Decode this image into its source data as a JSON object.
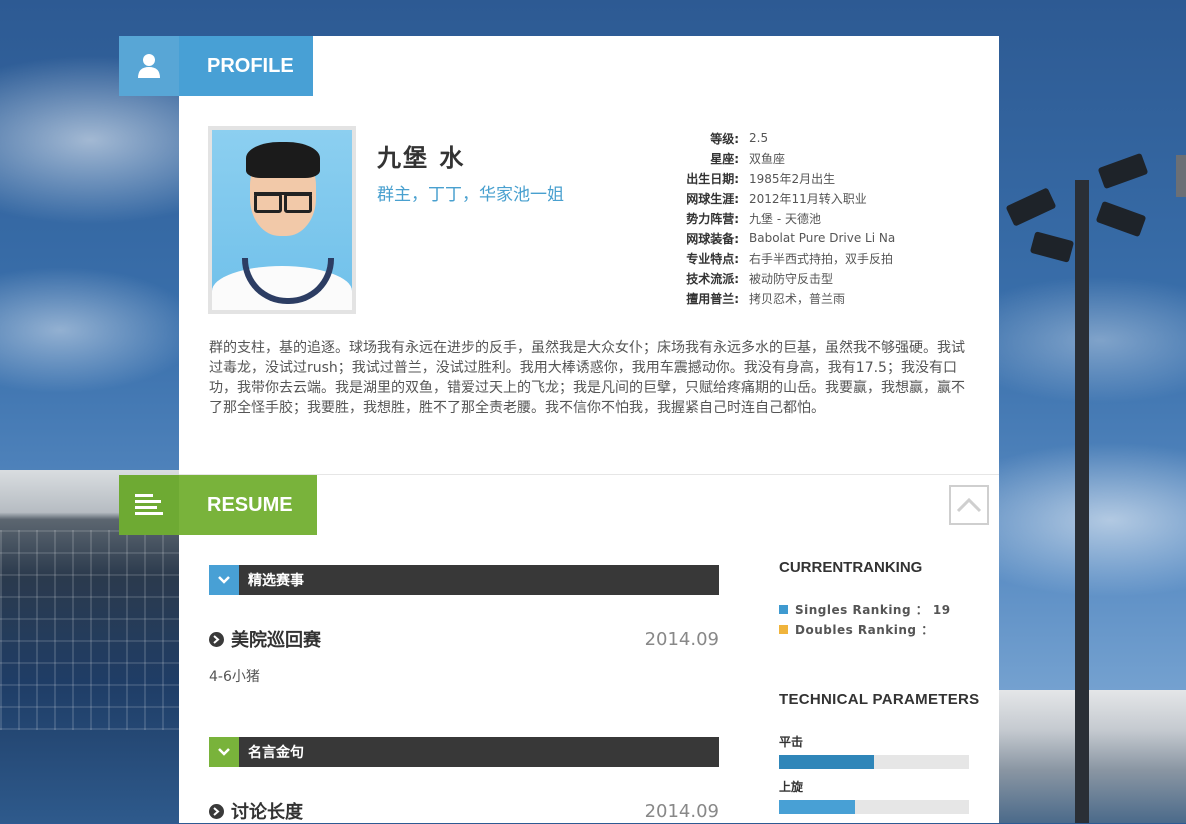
{
  "profile_tab": {
    "label": "PROFILE",
    "icon": "user-icon"
  },
  "resume_tab": {
    "label": "RESUME",
    "icon": "list-icon"
  },
  "player": {
    "name": "九堡 水",
    "aliases": "群主，丁丁，华家池一姐"
  },
  "info": [
    {
      "key": "等级:",
      "value": "2.5"
    },
    {
      "key": "星座:",
      "value": "双鱼座"
    },
    {
      "key": "出生日期:",
      "value": "1985年2月出生"
    },
    {
      "key": "网球生涯:",
      "value": "2012年11月转入职业"
    },
    {
      "key": "势力阵营:",
      "value": "九堡 - 天德池"
    },
    {
      "key": "网球装备:",
      "value": "Babolat Pure Drive Li Na"
    },
    {
      "key": "专业特点:",
      "value": "右手半西式持拍，双手反拍"
    },
    {
      "key": "技术流派:",
      "value": "被动防守反击型"
    },
    {
      "key": "擅用普兰:",
      "value": "拷贝忍术，普兰雨"
    }
  ],
  "bio": "群的支柱，基的追逐。球场我有永远在进步的反手，虽然我是大众女仆；床场我有永远多水的巨基，虽然我不够强硬。我试过毒龙，没试过rush；我试过普兰，没试过胜利。我用大棒诱惑你，我用车震撼动你。我没有身高，我有17.5；我没有口功，我带你去云端。我是湖里的双鱼，错爱过天上的飞龙；我是凡间的巨擘，只赋给疼痛期的山岳。我要赢，我想赢，赢不了那全怪手胶；我要胜，我想胜，胜不了那全责老腰。我不信你不怕我，我握紧自己时连自己都怕。",
  "sections": [
    {
      "title": "精选赛事",
      "color": "#48a0d5",
      "entry": {
        "title": "美院巡回赛",
        "date": "2014.09",
        "desc": "4-6小猪"
      }
    },
    {
      "title": "名言金句",
      "color": "#79b33b",
      "entry": {
        "title": "讨论长度",
        "date": "2014.09",
        "desc": ""
      }
    }
  ],
  "ranking": {
    "title": "CURRENTRANKING",
    "singles": "Singles Ranking ： 19",
    "doubles": "Doubles Ranking ：",
    "singles_color": "#3f9ad0",
    "doubles_color": "#f0b43c"
  },
  "technical": {
    "title": "TECHNICAL PARAMETERS",
    "params": [
      {
        "label": "平击",
        "level": 0.5,
        "color": "#2f86b9"
      },
      {
        "label": "上旋",
        "level": 0.4,
        "color": "#48a0d5"
      }
    ]
  }
}
